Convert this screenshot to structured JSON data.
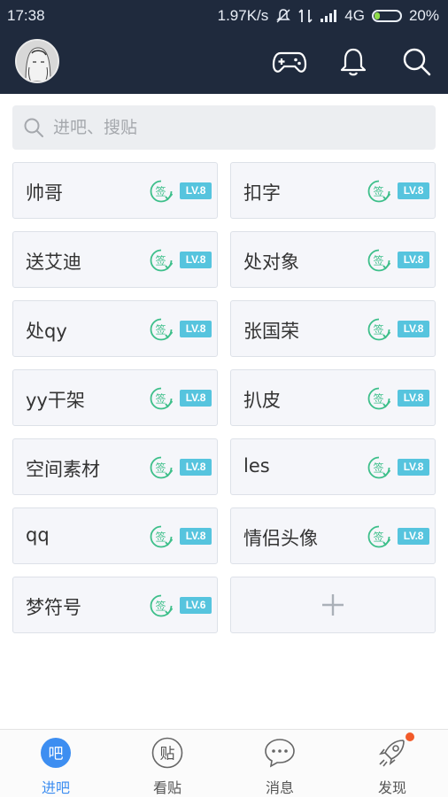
{
  "status_bar": {
    "time": "17:38",
    "net_speed": "1.97K/s",
    "network": "4G",
    "battery": "20%"
  },
  "search": {
    "placeholder": "进吧、搜贴"
  },
  "forums": [
    {
      "name": "帅哥",
      "level": "LV.8"
    },
    {
      "name": "扣字",
      "level": "LV.8"
    },
    {
      "name": "送艾迪",
      "level": "LV.8"
    },
    {
      "name": "处对象",
      "level": "LV.8"
    },
    {
      "name": "处qy",
      "level": "LV.8"
    },
    {
      "name": "张国荣",
      "level": "LV.8"
    },
    {
      "name": "yy干架",
      "level": "LV.8"
    },
    {
      "name": "扒皮",
      "level": "LV.8"
    },
    {
      "name": "空间素材",
      "level": "LV.8"
    },
    {
      "name": "les",
      "level": "LV.8"
    },
    {
      "name": "qq",
      "level": "LV.8"
    },
    {
      "name": "情侣头像",
      "level": "LV.8"
    },
    {
      "name": "梦符号",
      "level": "LV.6"
    }
  ],
  "tabs": [
    {
      "label": "进吧",
      "glyph": "吧",
      "active": true
    },
    {
      "label": "看贴",
      "glyph": "贴",
      "active": false
    },
    {
      "label": "消息",
      "glyph": "",
      "active": false
    },
    {
      "label": "发现",
      "glyph": "",
      "active": false
    }
  ],
  "colors": {
    "header": "#1f2a3d",
    "accent": "#3d8ef1",
    "sign_green": "#3dbf8a",
    "level_badge": "#56c4de",
    "notification_dot": "#f25b2a"
  },
  "icons": [
    "gamepad-icon",
    "bell-icon",
    "search-icon",
    "sign-in-icon",
    "plus-icon",
    "chat-bubble-icon",
    "rocket-icon"
  ]
}
